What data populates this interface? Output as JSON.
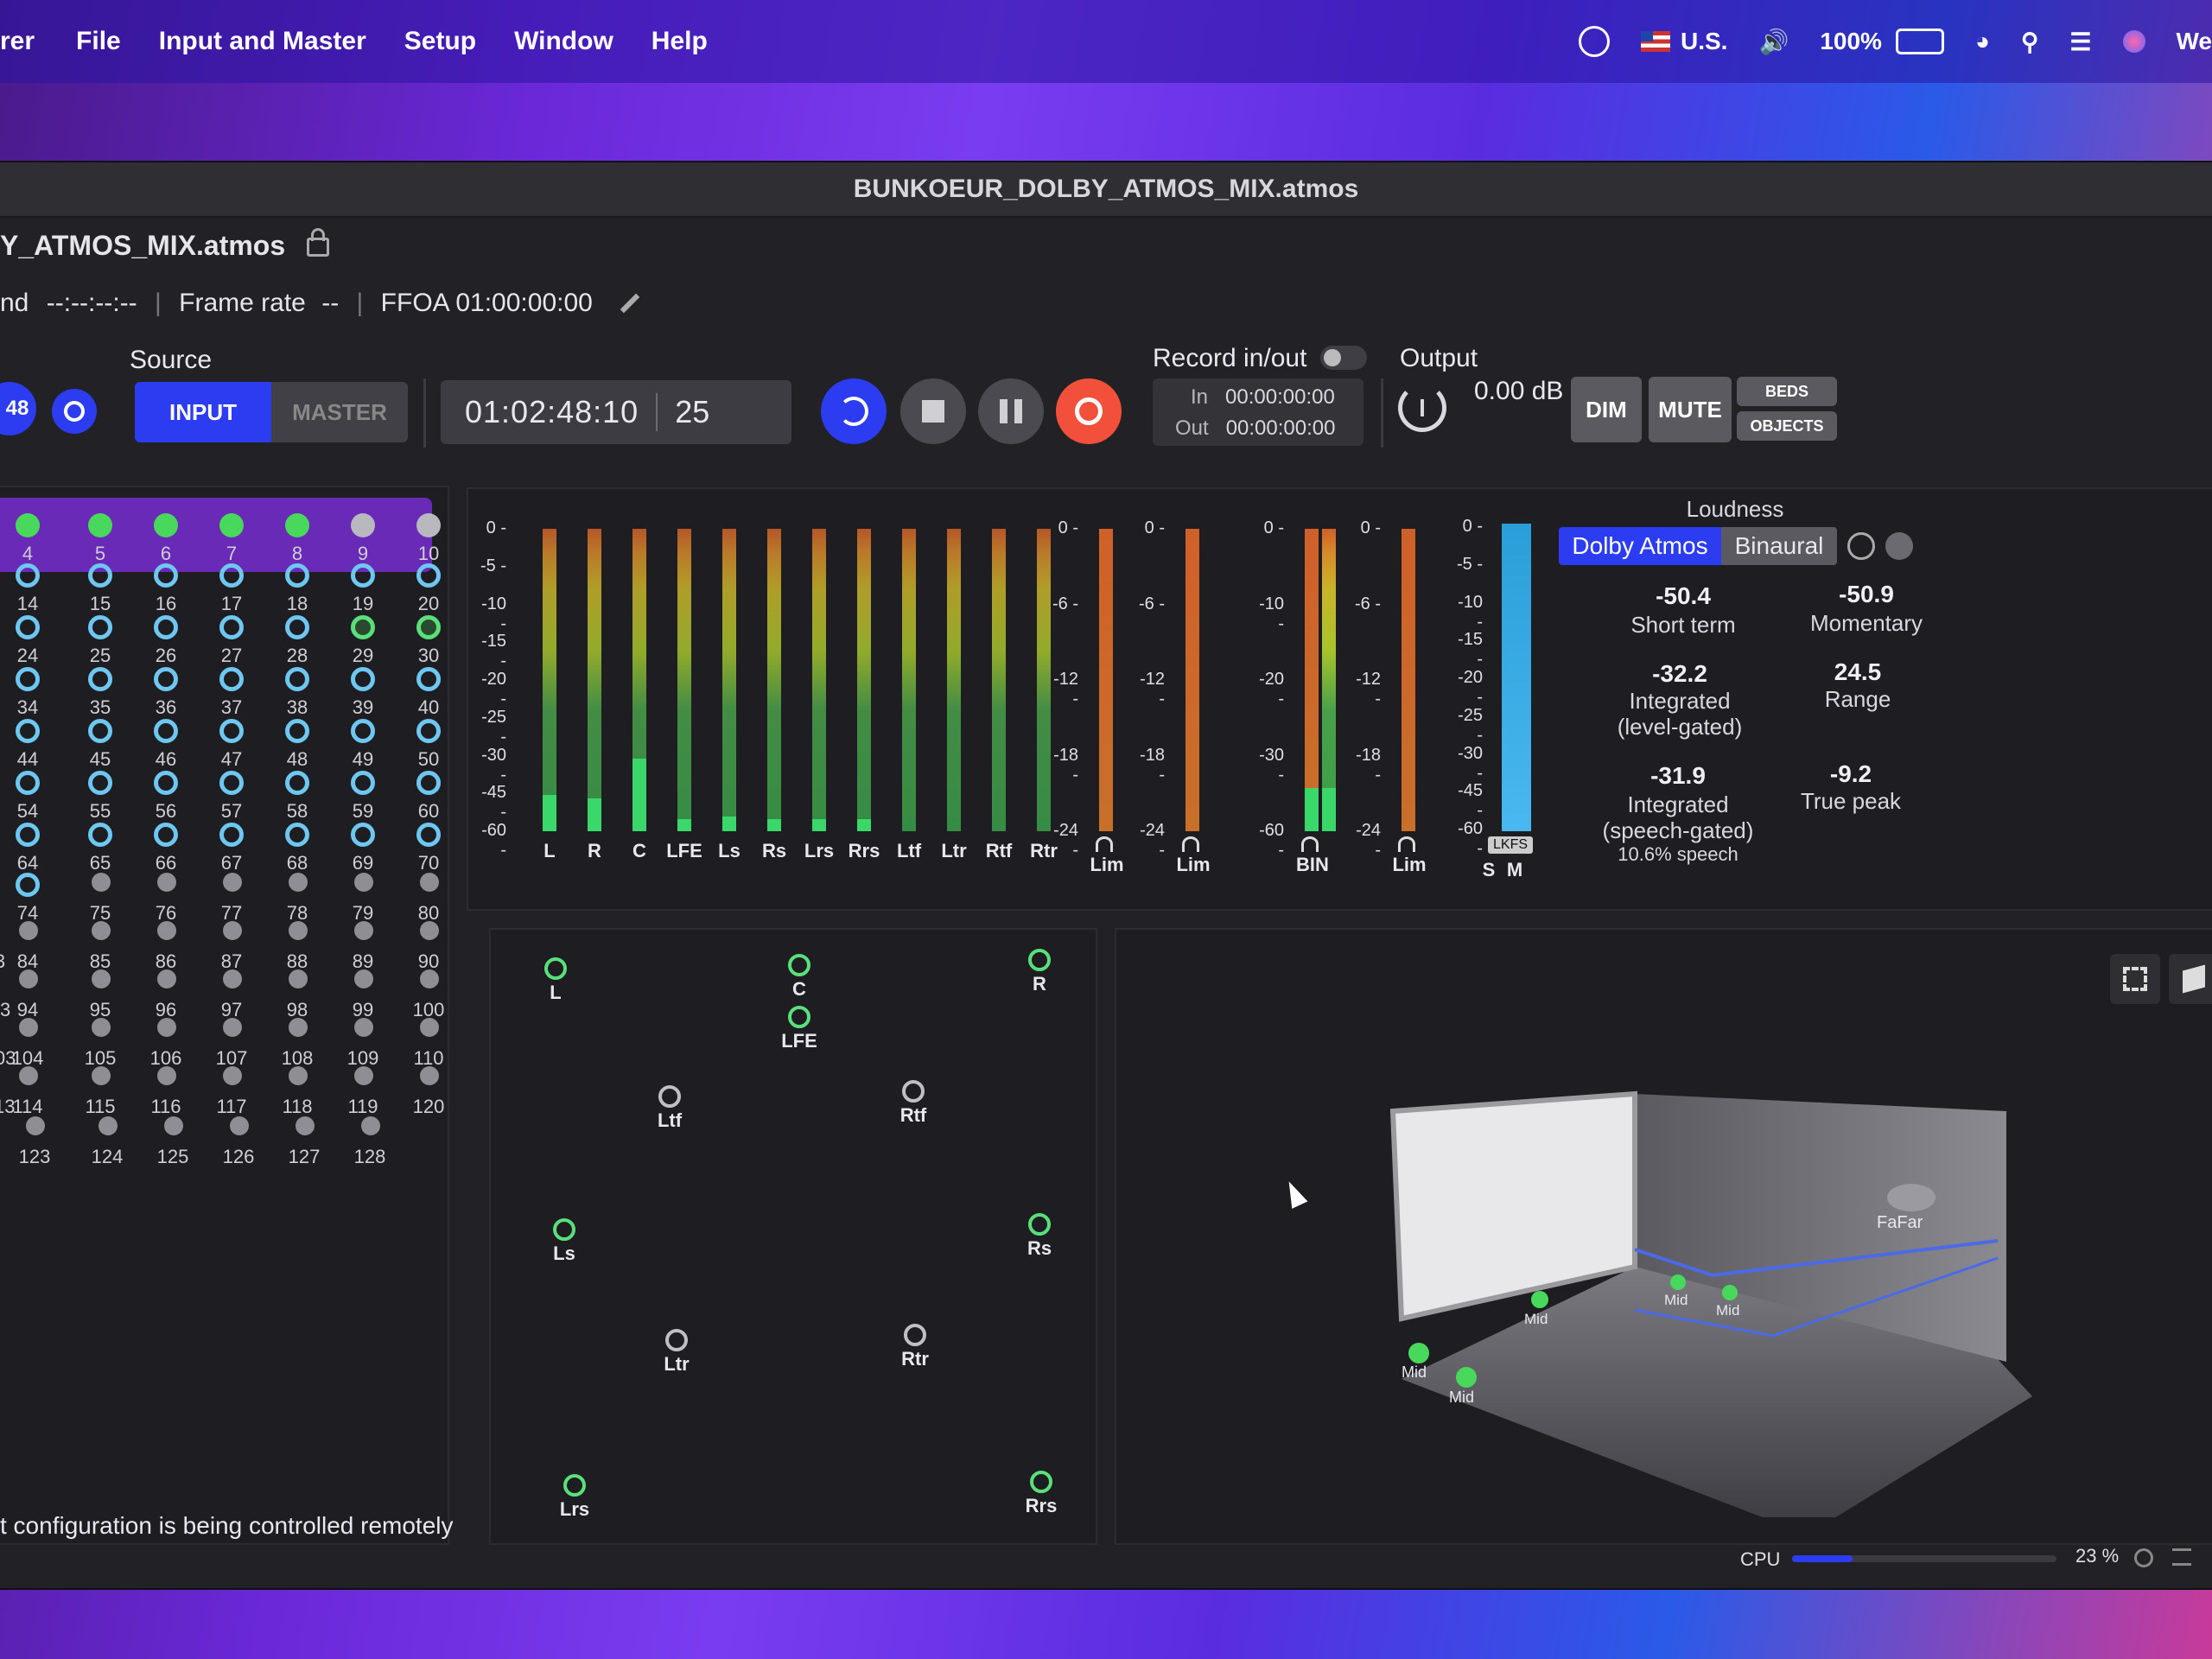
{
  "menubar": {
    "app_fragment": "rer",
    "items": [
      "File",
      "Input and Master",
      "Setup",
      "Window",
      "Help"
    ],
    "status": {
      "keyboard": "U.S.",
      "battery": "100%",
      "user_fragment": "We"
    }
  },
  "window": {
    "title": "BUNKOEUR_DOLBY_ATMOS_MIX.atmos"
  },
  "session": {
    "file_fragment": "Y_ATMOS_MIX.atmos",
    "tc_prefix": "nd",
    "tc_value": "--:--:--:--",
    "frame_rate_label": "Frame rate",
    "frame_rate_value": "--",
    "ffoa": "FFOA 01:00:00:00"
  },
  "source": {
    "label": "Source",
    "input": "INPUT",
    "master": "MASTER",
    "fragment_48": "48"
  },
  "transport": {
    "timecode": "01:02:48:10",
    "frame": "25"
  },
  "record": {
    "label": "Record in/out",
    "in_label": "In",
    "in_value": "00:00:00:00",
    "out_label": "Out",
    "out_value": "00:00:00:00"
  },
  "output": {
    "label": "Output",
    "level": "0.00 dB",
    "dim": "DIM",
    "mute": "MUTE",
    "beds": "BEDS",
    "objects": "OBJECTS"
  },
  "inputs": {
    "rows": [
      [
        "4",
        "5",
        "6",
        "7",
        "8",
        "9",
        "10"
      ],
      [
        "14",
        "15",
        "16",
        "17",
        "18",
        "19",
        "20"
      ],
      [
        "24",
        "25",
        "26",
        "27",
        "28",
        "29",
        "30"
      ],
      [
        "34",
        "35",
        "36",
        "37",
        "38",
        "39",
        "40"
      ],
      [
        "44",
        "45",
        "46",
        "47",
        "48",
        "49",
        "50"
      ],
      [
        "54",
        "55",
        "56",
        "57",
        "58",
        "59",
        "60"
      ],
      [
        "64",
        "65",
        "66",
        "67",
        "68",
        "69",
        "70"
      ],
      [
        "74",
        "75",
        "76",
        "77",
        "78",
        "79",
        "80"
      ],
      [
        "84",
        "85",
        "86",
        "87",
        "88",
        "89",
        "90"
      ],
      [
        "94",
        "95",
        "96",
        "97",
        "98",
        "99",
        "100"
      ],
      [
        "104",
        "105",
        "106",
        "107",
        "108",
        "109",
        "110"
      ],
      [
        "114",
        "115",
        "116",
        "117",
        "118",
        "119",
        "120"
      ],
      [
        "123",
        "124",
        "125",
        "126",
        "127",
        "128"
      ]
    ],
    "left_fragments": [
      "3",
      "93",
      "103",
      "113"
    ],
    "notice": "t configuration is being controlled remotely"
  },
  "meters": {
    "scale_main": [
      "0 -",
      "-5 -",
      "-10 -",
      "-15 -",
      "-20 -",
      "-25 -",
      "-30 -",
      "-45 -",
      "-60 -"
    ],
    "scale_lim": [
      "0 -",
      "-6 -",
      "-12 -",
      "-18 -",
      "-24 -"
    ],
    "channels": [
      "L",
      "R",
      "C",
      "LFE",
      "Ls",
      "Rs",
      "Lrs",
      "Rrs",
      "Ltf",
      "Ltr",
      "Rtf",
      "Rtr"
    ],
    "channel_levels": [
      0.12,
      0.11,
      0.24,
      0.04,
      0.05,
      0.04,
      0.04,
      0.04,
      0.0,
      0.0,
      0.0,
      0.0
    ],
    "lim_labels": [
      "Lim",
      "Lim",
      "BIN",
      "Lim"
    ],
    "lkfs": "LKFS",
    "sm": [
      "S",
      "M"
    ]
  },
  "loudness": {
    "title": "Loudness",
    "tabs": [
      "Dolby Atmos",
      "Binaural"
    ],
    "short_term": {
      "value": "-50.4",
      "label": "Short term"
    },
    "momentary": {
      "value": "-50.9",
      "label": "Momentary"
    },
    "integrated_level": {
      "value": "-32.2",
      "label1": "Integrated",
      "label2": "(level-gated)"
    },
    "range": {
      "value": "24.5",
      "label": "Range"
    },
    "integrated_speech": {
      "value": "-31.9",
      "label1": "Integrated",
      "label2": "(speech-gated)",
      "label3": "10.6% speech"
    },
    "true_peak": {
      "value": "-9.2",
      "label": "True peak"
    }
  },
  "speakers": [
    "L",
    "C",
    "R",
    "LFE",
    "Ltf",
    "Rtf",
    "Ls",
    "Rs",
    "Ltr",
    "Rtr",
    "Lrs",
    "Rrs"
  ],
  "view3d": {
    "far_label": "FaFar",
    "mid": "Mid"
  },
  "cpu": {
    "label": "CPU",
    "value": "23 %",
    "level": 0.23
  },
  "colors": {
    "accent": "#2c3cf0",
    "record": "#f2503a",
    "meter_green": "#3ad86a",
    "speaker_on": "#5ae07a"
  }
}
